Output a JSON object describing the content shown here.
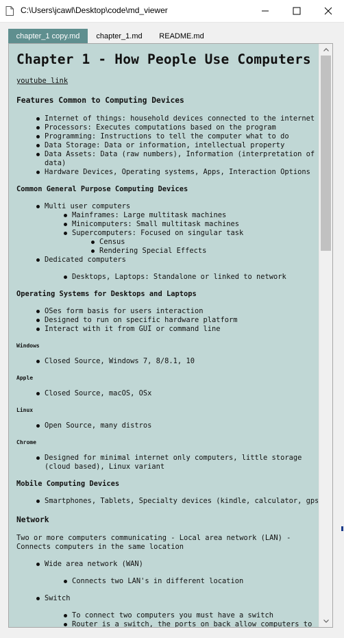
{
  "window": {
    "title": "C:\\Users\\jcawl\\Desktop\\code\\md_viewer",
    "min_icon": "minimize-icon",
    "max_icon": "maximize-icon",
    "close_icon": "close-icon"
  },
  "tabs": [
    {
      "label": "chapter_1 copy.md",
      "active": true
    },
    {
      "label": "chapter_1.md",
      "active": false
    },
    {
      "label": "README.md",
      "active": false
    }
  ],
  "colors": {
    "content_background": "#c0d7d5",
    "active_tab": "#5f8f8f",
    "titlebar": "#ffffff"
  },
  "doc": {
    "title": "Chapter 1 - How People Use Computers",
    "link": "youtube link",
    "s1_heading": "Features Common to Computing Devices",
    "s1_items": [
      "Internet of things: household devices connected to the internet",
      "Processors: Executes computations based on the program",
      "Programming: Instructions to tell the computer what to do",
      "Data Storage: Data or information, intellectual property",
      "Data Assets: Data (raw numbers), Information (interpretation of",
      "data)",
      "Hardware Devices, Operating systems, Apps, Interaction Options"
    ],
    "s2_heading": "Common General Purpose Computing Devices",
    "s2_items": [
      "Multi user computers",
      "Mainframes: Large multitask machines",
      "Minicomputers: Small multitask machines",
      "Supercomputers: Focused on singular task",
      "Census",
      "Rendering Special Effects",
      "Dedicated computers",
      "Desktops, Laptops: Standalone or linked to network"
    ],
    "s3_heading": "Operating Systems for Desktops and Laptops",
    "s3_items": [
      "OSes form basis for users interaction",
      "Designed to run on specific hardware platform",
      "Interact with it from GUI or command line"
    ],
    "windows_heading": "Windows",
    "windows_item": "Closed Source, Windows 7, 8/8.1, 10",
    "apple_heading": "Apple",
    "apple_item": "Closed Source, macOS, OSx",
    "linux_heading": "Linux",
    "linux_item": "Open Source, many distros",
    "chrome_heading": "Chrome",
    "chrome_items": [
      "Designed for minimal internet only computers, little storage",
      "(cloud based), Linux variant"
    ],
    "mobile_heading": "Mobile Computing Devices",
    "mobile_item": "Smartphones, Tablets, Specialty devices (kindle, calculator, gps)",
    "network_heading": "Network",
    "network_para": [
      "Two or more computers communicating - Local area network (LAN) -",
      "Connects computers in the same location"
    ],
    "net_items": [
      "Wide area network (WAN)",
      "Connects two LAN's in different location",
      "Switch",
      "To connect two computers you must have a switch",
      "Router is a switch, the ports on back allow computers to"
    ]
  }
}
